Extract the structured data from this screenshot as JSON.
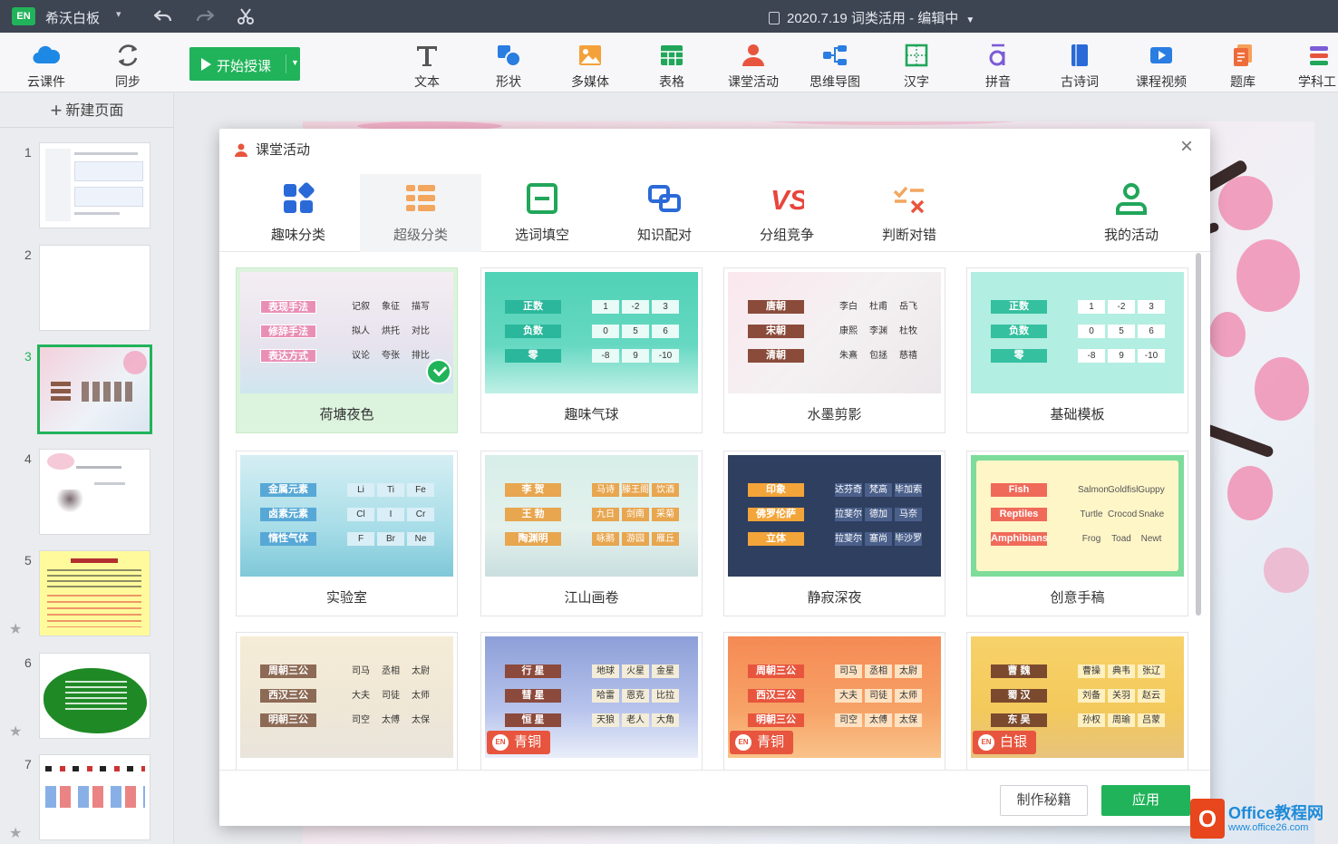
{
  "titlebar": {
    "app_badge": "EN",
    "app_name": "希沃白板",
    "document_title": "2020.7.19 词类活用 - 编辑中"
  },
  "toolbar": {
    "cloud_label": "云课件",
    "sync_label": "同步",
    "start_label": "开始授课",
    "tools": [
      "文本",
      "形状",
      "多媒体",
      "表格",
      "课堂活动",
      "思维导图",
      "汉字",
      "拼音",
      "古诗词",
      "课程视频",
      "题库",
      "学科工"
    ]
  },
  "sidebar": {
    "new_page": "新建页面",
    "slides": [
      "1",
      "2",
      "3",
      "4",
      "5",
      "6",
      "7"
    ],
    "active_slide": 3
  },
  "dialog": {
    "title": "课堂活动",
    "tabs": [
      "趣味分类",
      "超级分类",
      "选词填空",
      "知识配对",
      "分组竞争",
      "判断对错",
      "我的活动"
    ],
    "active_tab": 1,
    "templates": [
      {
        "name": "荷塘夜色",
        "selected": true,
        "labels": [
          "表现手法",
          "修辞手法",
          "表达方式"
        ],
        "words": [
          "记叙",
          "象征",
          "描写",
          "拟人",
          "烘托",
          "对比",
          "议论",
          "夸张",
          "排比"
        ]
      },
      {
        "name": "趣味气球",
        "labels": [
          "正数",
          "负数",
          "零"
        ],
        "words": [
          "1",
          "-2",
          "3",
          "0",
          "5",
          "6",
          "-8",
          "9",
          "-10"
        ]
      },
      {
        "name": "水墨剪影",
        "labels": [
          "唐朝",
          "宋朝",
          "清朝"
        ],
        "words": [
          "李白",
          "杜甫",
          "岳飞",
          "康熙",
          "李渊",
          "杜牧",
          "朱熹",
          "包拯",
          "慈禧"
        ]
      },
      {
        "name": "基础模板",
        "labels": [
          "正数",
          "负数",
          "零"
        ],
        "words": [
          "1",
          "-2",
          "3",
          "0",
          "5",
          "6",
          "-8",
          "9",
          "-10"
        ]
      },
      {
        "name": "实验室",
        "labels": [
          "金属元素",
          "卤素元素",
          "惰性气体"
        ],
        "words": [
          "Li",
          "Ti",
          "Fe",
          "Cl",
          "I",
          "Cr",
          "F",
          "Br",
          "Ne"
        ]
      },
      {
        "name": "江山画卷",
        "labels": [
          "李 贺",
          "王 勃",
          "陶渊明"
        ],
        "words": [
          "马诗",
          "滕王阁",
          "饮酒",
          "九日",
          "剑南",
          "采菊",
          "咏鹅",
          "游园",
          "雁丘"
        ]
      },
      {
        "name": "静寂深夜",
        "labels": [
          "印象",
          "佛罗伦萨",
          "立体"
        ],
        "words": [
          "达芬奇",
          "梵高",
          "毕加索",
          "拉斐尔",
          "德加",
          "马奈",
          "拉斐尔",
          "塞尚",
          "毕沙罗"
        ]
      },
      {
        "name": "创意手稿",
        "labels": [
          "Fish",
          "Reptiles",
          "Amphibians"
        ],
        "words": [
          "Salmon",
          "Goldfish",
          "Guppy",
          "Turtle",
          "Crocodile",
          "Snake",
          "Frog",
          "Toad",
          "Newt"
        ]
      },
      {
        "name": "",
        "labels": [
          "周朝三公",
          "西汉三公",
          "明朝三公"
        ],
        "words": [
          "司马",
          "丞相",
          "太尉",
          "大夫",
          "司徒",
          "太师",
          "司空",
          "太傅",
          "太保"
        ]
      },
      {
        "name": "",
        "labels": [
          "行 星",
          "彗 星",
          "恒 星"
        ],
        "words": [
          "地球",
          "火星",
          "金星",
          "哈雷",
          "恩克",
          "比拉",
          "天狼",
          "老人",
          "大角"
        ],
        "badge": "青铜"
      },
      {
        "name": "",
        "labels": [
          "周朝三公",
          "西汉三公",
          "明朝三公"
        ],
        "words": [
          "司马",
          "丞相",
          "太尉",
          "大夫",
          "司徒",
          "太师",
          "司空",
          "太傅",
          "太保"
        ],
        "badge": "青铜"
      },
      {
        "name": "",
        "labels": [
          "曹 魏",
          "蜀 汉",
          "东 吴"
        ],
        "words": [
          "曹操",
          "典韦",
          "张辽",
          "刘备",
          "关羽",
          "赵云",
          "孙权",
          "周瑜",
          "吕蒙"
        ],
        "badge": "白银"
      }
    ],
    "secret_button": "制作秘籍",
    "apply_button": "应用"
  },
  "watermark": {
    "line1": "Office教程网",
    "line2": "www.office26.com"
  },
  "colors": {
    "accent": "#21b35a",
    "titlebar": "#3d4452"
  }
}
